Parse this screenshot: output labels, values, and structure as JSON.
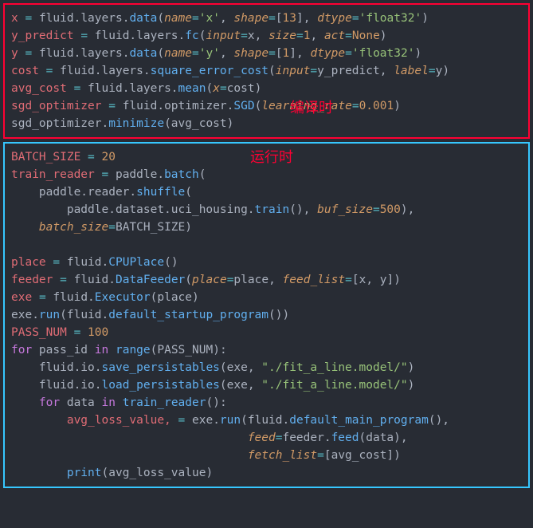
{
  "block1": {
    "label": "编译时",
    "l1": {
      "v": "x",
      "eq": "=",
      "p": "fluid.layers.",
      "fn": "data",
      "args": "(",
      "a1": "name",
      "e1": "=",
      "s1": "'x'",
      "c1": ", ",
      "a2": "shape",
      "e2": "=",
      "s2": "[",
      "n2": "13",
      "s2b": "]",
      "c2": ", ",
      "a3": "dtype",
      "e3": "=",
      "s3": "'float32'",
      "end": ")"
    },
    "l2": {
      "v": "y_predict",
      "eq": "=",
      "p": "fluid.layers.",
      "fn": "fc",
      "args": "(",
      "a1": "input",
      "e1": "=",
      "v1": "x",
      "c1": ", ",
      "a2": "size",
      "e2": "=",
      "n2": "1",
      "c2": ", ",
      "a3": "act",
      "e3": "=",
      "n3": "None",
      "end": ")"
    },
    "l3": {
      "v": "y",
      "eq": "=",
      "p": "fluid.layers.",
      "fn": "data",
      "args": "(",
      "a1": "name",
      "e1": "=",
      "s1": "'y'",
      "c1": ", ",
      "a2": "shape",
      "e2": "=",
      "s2": "[",
      "n2": "1",
      "s2b": "]",
      "c2": ", ",
      "a3": "dtype",
      "e3": "=",
      "s3": "'float32'",
      "end": ")"
    },
    "l4": {
      "v": "cost",
      "eq": "=",
      "p": "fluid.layers.",
      "fn": "square_error_cost",
      "args": "(",
      "a1": "input",
      "e1": "=",
      "v1": "y_predict",
      "c1": ", ",
      "a2": "label",
      "e2": "=",
      "v2": "y",
      "end": ")"
    },
    "l5": {
      "v": "avg_cost",
      "eq": "=",
      "p": "fluid.layers.",
      "fn": "mean",
      "args": "(",
      "a1": "x",
      "e1": "=",
      "v1": "cost",
      "end": ")"
    },
    "l6": {
      "v": "sgd_optimizer",
      "eq": "=",
      "p": "fluid.optimizer.",
      "fn": "SGD",
      "args": "(",
      "a1": "learning_rate",
      "e1": "=",
      "n1": "0.001",
      "end": ")"
    },
    "l7": {
      "v": "sgd_optimizer.",
      "fn": "minimize",
      "args": "(avg_cost)"
    }
  },
  "block2": {
    "label": "运行时",
    "l1": {
      "v": "BATCH_SIZE",
      "eq": "=",
      "n": "20"
    },
    "l2": {
      "v": "train_reader",
      "eq": "=",
      "p": "paddle.",
      "fn": "batch",
      "args": "("
    },
    "l3": {
      "p": "    paddle.reader.",
      "fn": "shuffle",
      "args": "("
    },
    "l4": {
      "p": "        paddle.dataset.uci_housing.",
      "fn": "train",
      "args": "(), ",
      "a1": "buf_size",
      "e1": "=",
      "n1": "500",
      "end": "),"
    },
    "l5": {
      "pad": "    ",
      "a1": "batch_size",
      "e1": "=",
      "v1": "BATCH_SIZE",
      "end": ")"
    },
    "l6": "",
    "l7": {
      "v": "place",
      "eq": "=",
      "p": "fluid.",
      "fn": "CPUPlace",
      "args": "()"
    },
    "l8": {
      "v": "feeder",
      "eq": "=",
      "p": "fluid.",
      "fn": "DataFeeder",
      "args": "(",
      "a1": "place",
      "e1": "=",
      "v1": "place",
      "c1": ", ",
      "a2": "feed_list",
      "e2": "=",
      "s2": "[x, y]",
      "end": ")"
    },
    "l9": {
      "v": "exe",
      "eq": "=",
      "p": "fluid.",
      "fn": "Executor",
      "args": "(place)"
    },
    "l10": {
      "v": "exe.",
      "fn": "run",
      "args": "(fluid.",
      "fn2": "default_startup_program",
      "args2": "())"
    },
    "l11": {
      "v": "PASS_NUM",
      "eq": "=",
      "n": "100"
    },
    "l12": {
      "k1": "for",
      "v": " pass_id ",
      "k2": "in",
      "sp": " ",
      "fn": "range",
      "args": "(PASS_NUM):"
    },
    "l13": {
      "p": "    fluid.io.",
      "fn": "save_persistables",
      "args": "(exe, ",
      "s": "\"./fit_a_line.model/\"",
      "end": ")"
    },
    "l14": {
      "p": "    fluid.io.",
      "fn": "load_persistables",
      "args": "(exe, ",
      "s": "\"./fit_a_line.model/\"",
      "end": ")"
    },
    "l15": {
      "pad": "    ",
      "k1": "for",
      "v": " data ",
      "k2": "in",
      "sp": " ",
      "fn": "train_reader",
      "args": "():"
    },
    "l16": {
      "pad": "        ",
      "v": "avg_loss_value,",
      "eq": " = ",
      "p": "exe.",
      "fn": "run",
      "args": "(fluid.",
      "fn2": "default_main_program",
      "args2": "(),"
    },
    "l17": {
      "pad": "                                  ",
      "a1": "feed",
      "e1": "=",
      "p": "feeder.",
      "fn": "feed",
      "args": "(data),"
    },
    "l18": {
      "pad": "                                  ",
      "a1": "fetch_list",
      "e1": "=",
      "s": "[avg_cost]",
      "end": ")"
    },
    "l19": {
      "pad": "        ",
      "fn": "print",
      "args": "(avg_loss_value)"
    }
  }
}
